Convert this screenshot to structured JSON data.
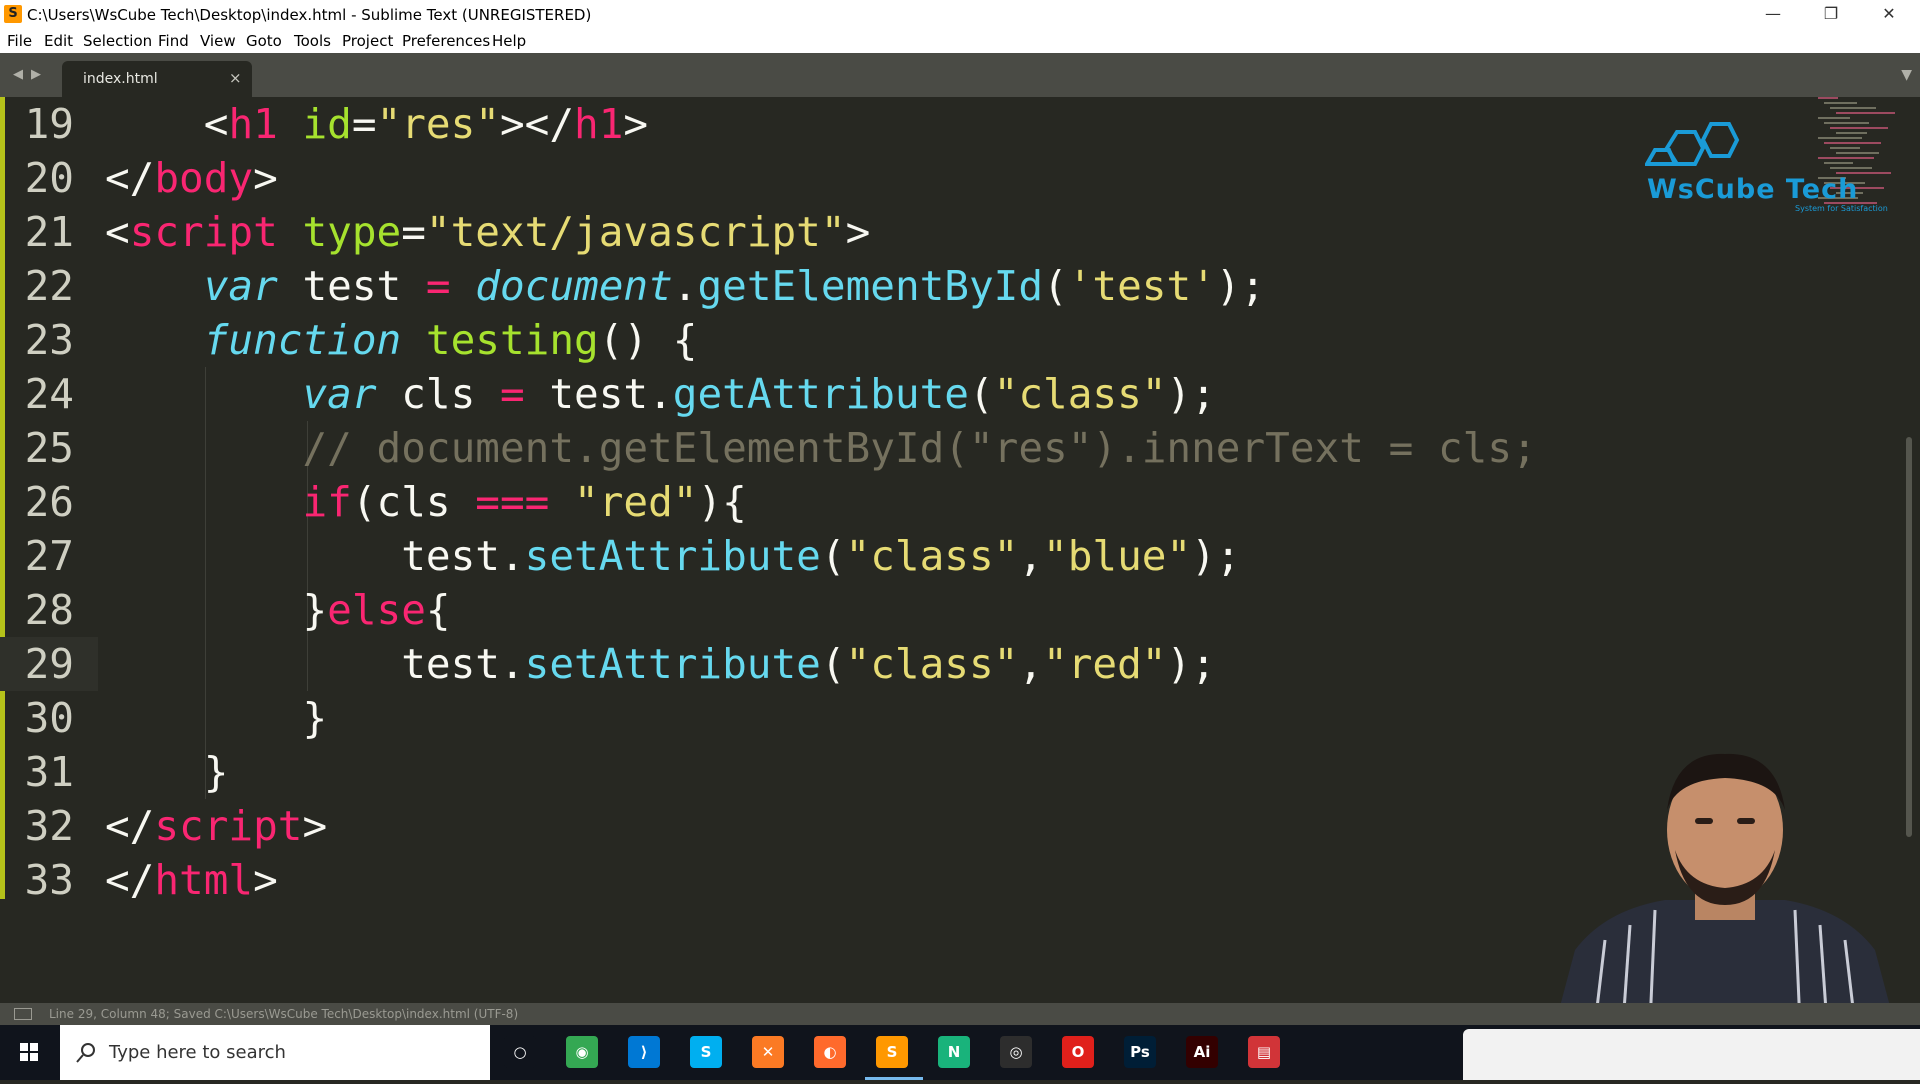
{
  "window": {
    "title": "C:\\Users\\WsCube Tech\\Desktop\\index.html - Sublime Text (UNREGISTERED)",
    "minimize": "—",
    "maximize": "❐",
    "close": "✕"
  },
  "menu": [
    "File",
    "Edit",
    "Selection",
    "Find",
    "View",
    "Goto",
    "Tools",
    "Project",
    "Preferences",
    "Help"
  ],
  "tab": {
    "label": "index.html",
    "close": "×"
  },
  "editor": {
    "active_line": "29",
    "lines": [
      {
        "num": "19",
        "indent": "    ",
        "tokens": [
          [
            "pl",
            "<"
          ],
          [
            "tag",
            "h1"
          ],
          [
            "pl",
            " "
          ],
          [
            "attr",
            "id"
          ],
          [
            "pl",
            "="
          ],
          [
            "str",
            "\"res\""
          ],
          [
            "pl",
            "></"
          ],
          [
            "tag",
            "h1"
          ],
          [
            "pl",
            ">"
          ]
        ]
      },
      {
        "num": "20",
        "indent": "",
        "tokens": [
          [
            "pl",
            "</"
          ],
          [
            "tag",
            "body"
          ],
          [
            "pl",
            ">"
          ]
        ]
      },
      {
        "num": "21",
        "indent": "",
        "tokens": [
          [
            "pl",
            "<"
          ],
          [
            "tag",
            "script"
          ],
          [
            "pl",
            " "
          ],
          [
            "attr",
            "type"
          ],
          [
            "pl",
            "="
          ],
          [
            "str",
            "\"text/javascript\""
          ],
          [
            "pl",
            ">"
          ]
        ]
      },
      {
        "num": "22",
        "indent": "    ",
        "tokens": [
          [
            "kw",
            "var"
          ],
          [
            "pl",
            " test "
          ],
          [
            "op",
            "="
          ],
          [
            "pl",
            " "
          ],
          [
            "kw",
            "document"
          ],
          [
            "pl",
            "."
          ],
          [
            "fn",
            "getElementById"
          ],
          [
            "pl",
            "("
          ],
          [
            "str",
            "'test'"
          ],
          [
            "pl",
            ");"
          ]
        ]
      },
      {
        "num": "23",
        "indent": "    ",
        "tokens": [
          [
            "kw",
            "function"
          ],
          [
            "pl",
            " "
          ],
          [
            "name",
            "testing"
          ],
          [
            "pl",
            "() {"
          ]
        ]
      },
      {
        "num": "24",
        "indent": "        ",
        "tokens": [
          [
            "kw",
            "var"
          ],
          [
            "pl",
            " cls "
          ],
          [
            "op",
            "="
          ],
          [
            "pl",
            " test."
          ],
          [
            "fn",
            "getAttribute"
          ],
          [
            "pl",
            "("
          ],
          [
            "str",
            "\"class\""
          ],
          [
            "pl",
            ");"
          ]
        ]
      },
      {
        "num": "25",
        "indent": "        ",
        "tokens": [
          [
            "cm",
            "// document.getElementById(\"res\").innerText = cls;"
          ]
        ]
      },
      {
        "num": "26",
        "indent": "        ",
        "tokens": [
          [
            "op",
            "if"
          ],
          [
            "pl",
            "(cls "
          ],
          [
            "op",
            "==="
          ],
          [
            "pl",
            " "
          ],
          [
            "str",
            "\"red\""
          ],
          [
            "pl",
            "){"
          ]
        ]
      },
      {
        "num": "27",
        "indent": "            ",
        "tokens": [
          [
            "pl",
            "test."
          ],
          [
            "fn",
            "setAttribute"
          ],
          [
            "pl",
            "("
          ],
          [
            "str",
            "\"class\""
          ],
          [
            "pl",
            ","
          ],
          [
            "str",
            "\"blue\""
          ],
          [
            "pl",
            ");"
          ]
        ]
      },
      {
        "num": "28",
        "indent": "        ",
        "tokens": [
          [
            "pl",
            "}"
          ],
          [
            "op",
            "else"
          ],
          [
            "pl",
            "{"
          ]
        ]
      },
      {
        "num": "29",
        "indent": "            ",
        "tokens": [
          [
            "pl",
            "test."
          ],
          [
            "fn",
            "setAttribute"
          ],
          [
            "pl",
            "("
          ],
          [
            "str",
            "\"class\""
          ],
          [
            "pl",
            ","
          ],
          [
            "str",
            "\"red\""
          ],
          [
            "pl",
            ");"
          ]
        ]
      },
      {
        "num": "30",
        "indent": "        ",
        "tokens": [
          [
            "pl",
            "}"
          ]
        ]
      },
      {
        "num": "31",
        "indent": "    ",
        "tokens": [
          [
            "pl",
            "}"
          ]
        ]
      },
      {
        "num": "32",
        "indent": "",
        "tokens": [
          [
            "pl",
            "</"
          ],
          [
            "tag",
            "script"
          ],
          [
            "pl",
            ">"
          ]
        ]
      },
      {
        "num": "33",
        "indent": "",
        "tokens": [
          [
            "pl",
            "</"
          ],
          [
            "tag",
            "html"
          ],
          [
            "pl",
            ">"
          ]
        ]
      }
    ]
  },
  "logo": {
    "text": "WsCube Tech",
    "subtitle": "System for Satisfaction",
    "color": "#1a9bd7"
  },
  "statusbar": {
    "text": "Line 29, Column 48; Saved C:\\Users\\WsCube Tech\\Desktop\\index.html (UTF-8)"
  },
  "taskbar": {
    "search_placeholder": "Type here to search",
    "apps": [
      {
        "name": "cortana-icon",
        "glyph": "○",
        "color": "#10141c"
      },
      {
        "name": "chrome-icon",
        "glyph": "◉",
        "color": "#34a853"
      },
      {
        "name": "vscode-icon",
        "glyph": "⟩",
        "color": "#0078d4"
      },
      {
        "name": "skype-icon",
        "glyph": "S",
        "color": "#00aff0"
      },
      {
        "name": "xampp-icon",
        "glyph": "✕",
        "color": "#fb7a24"
      },
      {
        "name": "firefox-icon",
        "glyph": "◐",
        "color": "#ff6a2c"
      },
      {
        "name": "sublime-icon",
        "glyph": "S",
        "color": "#ff9800"
      },
      {
        "name": "notepad-app-icon",
        "glyph": "N",
        "color": "#19b37b"
      },
      {
        "name": "obs-icon",
        "glyph": "◎",
        "color": "#2d2d2d"
      },
      {
        "name": "opera-icon",
        "glyph": "O",
        "color": "#e0201b"
      },
      {
        "name": "photoshop-icon",
        "glyph": "Ps",
        "color": "#001e36"
      },
      {
        "name": "illustrator-icon",
        "glyph": "Ai",
        "color": "#330000"
      },
      {
        "name": "document-viewer-icon",
        "glyph": "▤",
        "color": "#d13438"
      }
    ]
  }
}
